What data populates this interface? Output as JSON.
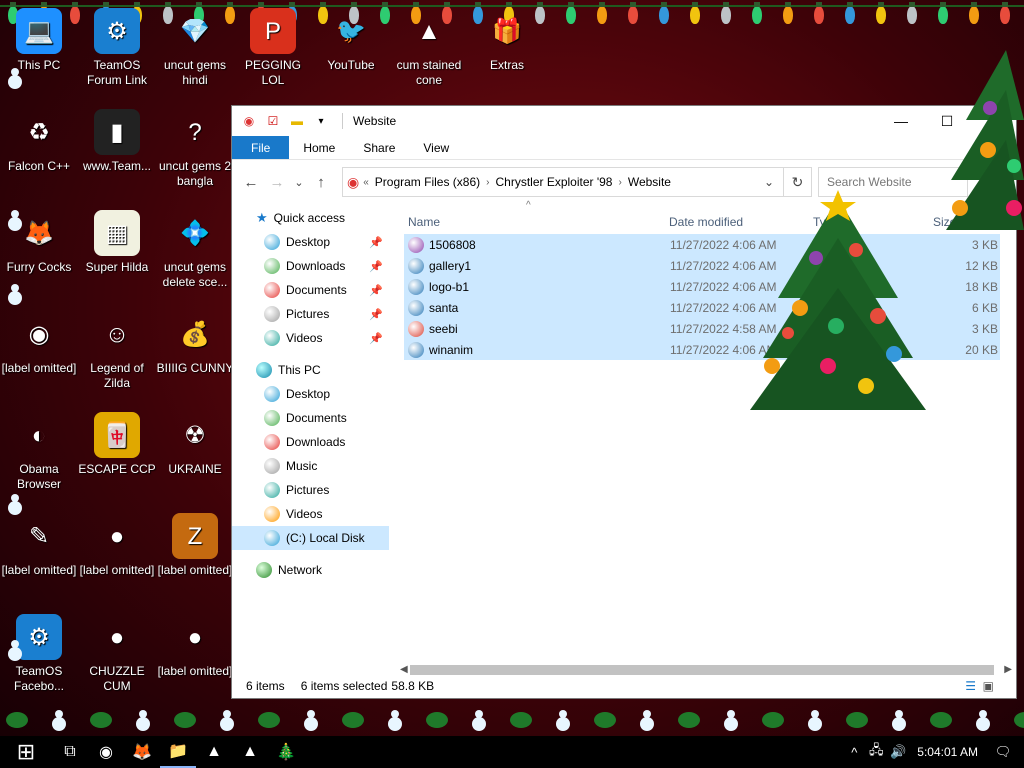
{
  "desktop": {
    "icons": [
      {
        "label": "This PC",
        "glyph": "💻",
        "bg": "#1e90ff"
      },
      {
        "label": "TeamOS Forum Link",
        "glyph": "⚙",
        "bg": "#1a7fd0"
      },
      {
        "label": "uncut gems hindi",
        "glyph": "💎",
        "bg": "transparent"
      },
      {
        "label": "PEGGING LOL",
        "glyph": "P",
        "bg": "#d9301c"
      },
      {
        "label": "YouTube",
        "glyph": "🐦",
        "bg": "transparent"
      },
      {
        "label": "cum stained cone",
        "glyph": "▲",
        "bg": "transparent"
      },
      {
        "label": "Extras",
        "glyph": "🎁",
        "bg": "transparent"
      },
      {
        "label": "Falcon C++",
        "glyph": "♻",
        "bg": "transparent"
      },
      {
        "label": "www.Team...",
        "glyph": "▮",
        "bg": "#222222"
      },
      {
        "label": "uncut gems 2 bangla",
        "glyph": "?",
        "bg": "transparent"
      },
      {
        "label": "Furry Cocks",
        "glyph": "🦊",
        "bg": "transparent"
      },
      {
        "label": "Super Hilda",
        "glyph": "▦",
        "bg": "#f1f1e0"
      },
      {
        "label": "uncut gems delete sce...",
        "glyph": "💠",
        "bg": "transparent"
      },
      {
        "label": "[label omitted]",
        "glyph": "◉",
        "bg": "transparent"
      },
      {
        "label": "Legend of Zilda",
        "glyph": "☺",
        "bg": "transparent"
      },
      {
        "label": "BIIIIG CUNNY",
        "glyph": "💰",
        "bg": "transparent"
      },
      {
        "label": "Obama Browser",
        "glyph": "◐",
        "bg": "transparent"
      },
      {
        "label": "ESCAPE CCP",
        "glyph": "🀄",
        "bg": "#e0a800"
      },
      {
        "label": "UKRAINE",
        "glyph": "☢",
        "bg": "transparent"
      },
      {
        "label": "[label omitted]",
        "glyph": "✎",
        "bg": "transparent"
      },
      {
        "label": "[label omitted]",
        "glyph": "●",
        "bg": "transparent"
      },
      {
        "label": "[label omitted]",
        "glyph": "Z",
        "bg": "#c46a10"
      },
      {
        "label": "TeamOS Facebo...",
        "glyph": "⚙",
        "bg": "#1a7fd0"
      },
      {
        "label": "CHUZZLE CUM",
        "glyph": "●",
        "bg": "transparent"
      },
      {
        "label": "[label omitted]",
        "glyph": "●",
        "bg": "transparent"
      }
    ]
  },
  "window": {
    "title": "Website",
    "controls": {
      "minimize": "—",
      "maximize": "☐",
      "close": "✕"
    },
    "ribbon_tabs": [
      "File",
      "Home",
      "Share",
      "View"
    ],
    "nav": {
      "back": "←",
      "forward": "→",
      "recent": "⌄",
      "up": "↑"
    },
    "address": {
      "overflow": "«",
      "crumbs": [
        "Program Files (x86)",
        "Chrystler Exploiter '98",
        "Website"
      ],
      "separator": "›",
      "dropdown": "⌄",
      "refresh": "↻"
    },
    "search_placeholder": "Search Website",
    "nav_pane": {
      "quick_access": "Quick access",
      "quick_items": [
        "Desktop",
        "Downloads",
        "Documents",
        "Pictures",
        "Videos"
      ],
      "pin_glyph": "📌",
      "this_pc": "This PC",
      "pc_items": [
        "Desktop",
        "Documents",
        "Downloads",
        "Music",
        "Pictures",
        "Videos",
        "(C:) Local Disk"
      ],
      "network": "Network"
    },
    "columns": {
      "name": "Name",
      "date": "Date modified",
      "type": "Type",
      "size": "Size",
      "sort_glyph": "^"
    },
    "files": [
      {
        "name": "1506808",
        "date": "11/27/2022 4:06 AM",
        "size": "3 KB",
        "color": "#8e44ad"
      },
      {
        "name": "gallery1",
        "date": "11/27/2022 4:06 AM",
        "size": "12 KB",
        "color": "#2a7ab8"
      },
      {
        "name": "logo-b1",
        "date": "11/27/2022 4:06 AM",
        "size": "18 KB",
        "color": "#2a7ab8"
      },
      {
        "name": "santa",
        "date": "11/27/2022 4:06 AM",
        "size": "6 KB",
        "color": "#2a7ab8"
      },
      {
        "name": "seebi",
        "date": "11/27/2022 4:58 AM",
        "size": "3 KB",
        "color": "#db4437"
      },
      {
        "name": "winanim",
        "date": "11/27/2022 4:06 AM",
        "size": "20 KB",
        "color": "#2a7ab8"
      }
    ],
    "status": {
      "count": "6 items",
      "selected": "6 items selected",
      "size": "58.8 KB"
    }
  },
  "taskbar": {
    "start": "⊞",
    "items": [
      "⧉",
      "◉",
      "🦊",
      "📁",
      "▲",
      "▲",
      "🎄"
    ],
    "tray": {
      "chevron": "^",
      "network": "🖧",
      "volume": "🔊",
      "time": "5:04:01 AM",
      "notifications": "🗨"
    }
  },
  "colors": {
    "ribbon_file": "#1979ca",
    "selection": "#cce8ff",
    "desktop_bg": "#5a0610"
  }
}
